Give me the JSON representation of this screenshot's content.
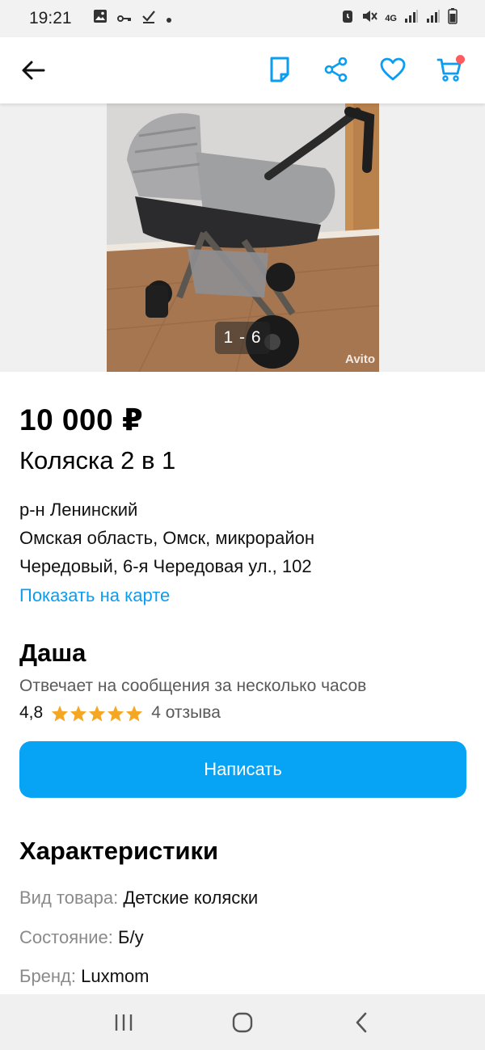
{
  "status_bar": {
    "time": "19:21",
    "network": "4G"
  },
  "colors": {
    "accent": "#07a3f4",
    "link": "#0a9df2",
    "icon_blue": "#0a9df2",
    "star": "#f5a623",
    "cart_badge": "#ff5a5f"
  },
  "appbar": {
    "icons": [
      "back-arrow-icon",
      "note-icon",
      "share-icon",
      "heart-icon",
      "cart-icon"
    ]
  },
  "gallery": {
    "counter": "1 - 6",
    "watermark": "Avito"
  },
  "listing": {
    "price": "10 000 ₽",
    "title": "Коляска 2 в 1",
    "address_line1": "р-н Ленинский",
    "address_line2": "Омская область, Омск, микрорайон",
    "address_line3": "Чередовый, 6-я Чередовая ул., 102",
    "map_link": "Показать на карте"
  },
  "seller": {
    "name": "Даша",
    "response": "Отвечает на сообщения за несколько часов",
    "rating": "4,8",
    "stars": 5,
    "reviews": "4 отзыва"
  },
  "actions": {
    "write_label": "Написать"
  },
  "characteristics": {
    "title": "Характеристики",
    "rows": [
      {
        "key": "Вид товара:",
        "value": "Детские коляски"
      },
      {
        "key": "Состояние:",
        "value": "Б/у"
      },
      {
        "key": "Бренд:",
        "value": "Luxmom"
      }
    ]
  },
  "navbar": {
    "icons": [
      "recents-icon",
      "home-icon",
      "back-icon"
    ]
  }
}
